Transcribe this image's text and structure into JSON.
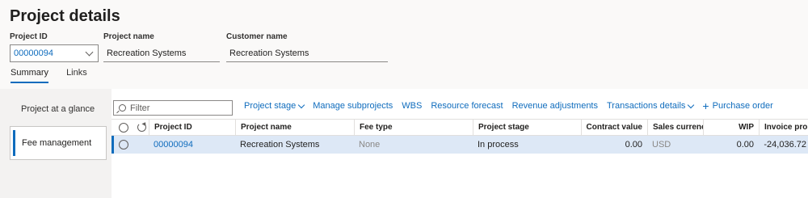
{
  "page": {
    "title": "Project details"
  },
  "header_fields": {
    "project_id": {
      "label": "Project ID",
      "value": "00000094"
    },
    "project_name": {
      "label": "Project name",
      "value": "Recreation Systems"
    },
    "customer_name": {
      "label": "Customer name",
      "value": "Recreation Systems"
    }
  },
  "tabs": [
    {
      "label": "Summary",
      "active": true
    },
    {
      "label": "Links",
      "active": false
    }
  ],
  "nav": {
    "items": [
      {
        "label": "Project at a glance",
        "selected": false
      },
      {
        "label": "Fee management",
        "selected": true
      }
    ]
  },
  "filter": {
    "placeholder": "Filter"
  },
  "toolbar": {
    "project_stage": "Project stage",
    "manage_subprojects": "Manage subprojects",
    "wbs": "WBS",
    "resource_forecast": "Resource forecast",
    "revenue_adjustments": "Revenue adjustments",
    "transactions_details": "Transactions details",
    "purchase_order": "Purchase order"
  },
  "grid": {
    "columns": {
      "project_id": "Project ID",
      "project_name": "Project name",
      "fee_type": "Fee type",
      "project_stage": "Project stage",
      "contract_value": "Contract value",
      "sales_currency": "Sales currency",
      "wip": "WIP",
      "invoice_proposal": "Invoice proposal"
    },
    "rows": [
      {
        "project_id": "00000094",
        "project_name": "Recreation Systems",
        "fee_type": "None",
        "project_stage": "In process",
        "contract_value": "0.00",
        "sales_currency": "USD",
        "wip": "0.00",
        "invoice_proposal": "-24,036.72"
      }
    ]
  },
  "colors": {
    "accent": "#0f6cbd",
    "selected_row": "#dde8f6"
  }
}
